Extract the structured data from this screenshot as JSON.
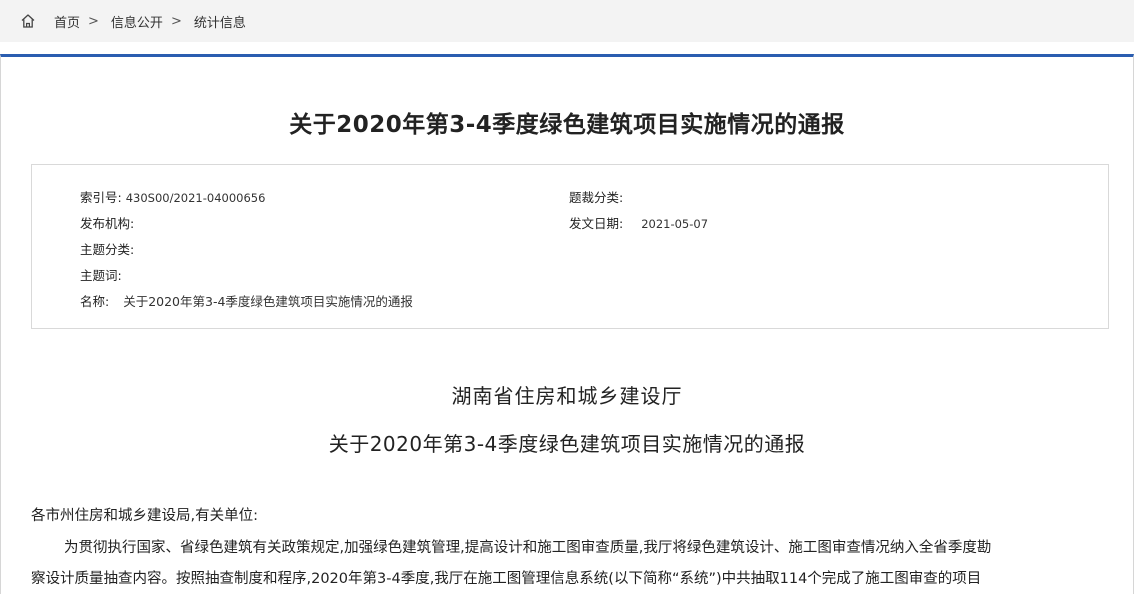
{
  "breadcrumb": {
    "home_icon": "home-icon",
    "items": [
      "首页",
      "信息公开",
      "统计信息"
    ],
    "separator": ">"
  },
  "article": {
    "title": "关于2020年第3-4季度绿色建筑项目实施情况的通报",
    "meta": {
      "index_label": "索引号:",
      "index_value": "430S00/2021-04000656",
      "category_label": "题裁分类:",
      "category_value": "",
      "publisher_label": "发布机构:",
      "publisher_value": "",
      "date_label": "发文日期:",
      "date_value": "2021-05-07",
      "topic_label": "主题分类:",
      "topic_value": "",
      "keywords_label": "主题词:",
      "keywords_value": "",
      "name_label": "名称:",
      "name_value": "关于2020年第3-4季度绿色建筑项目实施情况的通报"
    },
    "org": "湖南省住房和城乡建设厅",
    "subtitle": "关于2020年第3-4季度绿色建筑项目实施情况的通报",
    "salutation": "各市州住房和城乡建设局,有关单位:",
    "paragraph_line1": "为贯彻执行国家、省绿色建筑有关政策规定,加强绿色建筑管理,提高设计和施工图审查质量,我厅将绿色建筑设计、施工图审查情况纳入全省季度勘",
    "paragraph_line2": "察设计质量抽查内容。按照抽查制度和程序,2020年第3-4季度,我厅在施工图管理信息系统(以下简称“系统”)中共抽取114个完成了施工图审查的项目"
  }
}
